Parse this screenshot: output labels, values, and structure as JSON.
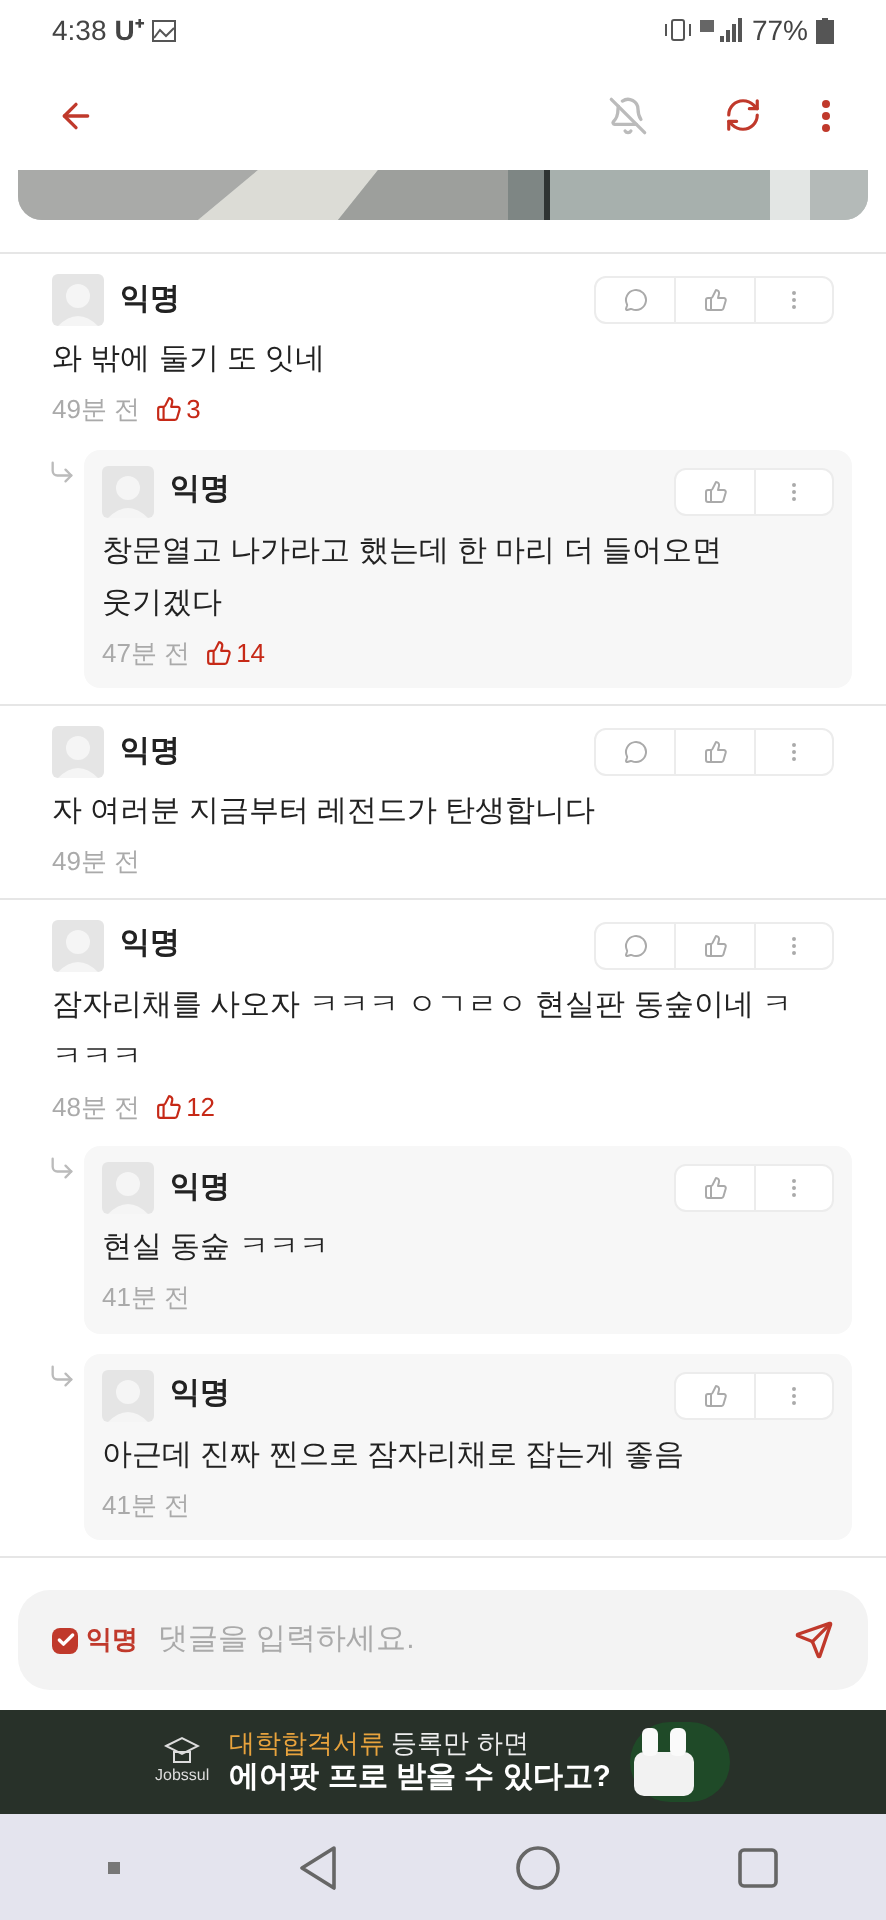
{
  "status_bar": {
    "time": "4:38",
    "carrier": "U⁺",
    "battery": "77%"
  },
  "comments": [
    {
      "author": "익명",
      "text": "와 밖에 둘기 또 잇네",
      "time": "49분 전",
      "likes": "3",
      "replies": [
        {
          "author": "익명",
          "text": "창문열고 나가라고 했는데 한 마리 더 들어오면 웃기겠다",
          "time": "47분 전",
          "likes": "14"
        }
      ]
    },
    {
      "author": "익명",
      "text": "자 여러분 지금부터 레전드가 탄생합니다",
      "time": "49분 전"
    },
    {
      "author": "익명",
      "text": "잠자리채를 사오자 ㅋㅋㅋ ㅇㄱㄹㅇ 현실판 동숲이네 ㅋㅋㅋㅋ",
      "time": "48분 전",
      "likes": "12",
      "replies": [
        {
          "author": "익명",
          "text": "현실 동숲 ㅋㅋㅋ",
          "time": "41분 전"
        },
        {
          "author": "익명",
          "text": "아근데 진짜 찐으로 잠자리채로 잡는게 좋음",
          "time": "41분 전"
        }
      ]
    }
  ],
  "composer": {
    "anonymous_label": "익명",
    "anonymous_checked": true,
    "placeholder": "댓글을 입력하세요."
  },
  "ad": {
    "logo": "Jobssul",
    "highlight": "대학합격서류",
    "line1_rest": "등록만 하면",
    "line2": "에어팟 프로 받을 수 있다고?"
  }
}
